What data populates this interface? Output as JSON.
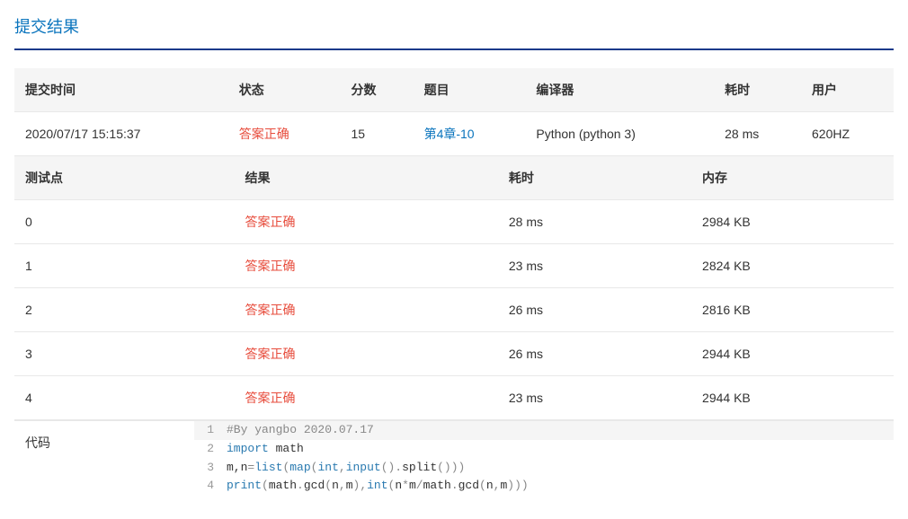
{
  "page_title": "提交结果",
  "summary": {
    "headers": {
      "submit_time": "提交时间",
      "status": "状态",
      "score": "分数",
      "problem": "题目",
      "compiler": "编译器",
      "time": "耗时",
      "user": "用户"
    },
    "row": {
      "submit_time": "2020/07/17 15:15:37",
      "status": "答案正确",
      "score": "15",
      "problem": "第4章-10",
      "compiler": "Python (python 3)",
      "time": "28 ms",
      "user": "620HZ"
    }
  },
  "testcases": {
    "headers": {
      "testcase": "测试点",
      "result": "结果",
      "time": "耗时",
      "memory": "内存"
    },
    "rows": [
      {
        "id": "0",
        "result": "答案正确",
        "time": "28 ms",
        "memory": "2984 KB"
      },
      {
        "id": "1",
        "result": "答案正确",
        "time": "23 ms",
        "memory": "2824 KB"
      },
      {
        "id": "2",
        "result": "答案正确",
        "time": "26 ms",
        "memory": "2816 KB"
      },
      {
        "id": "3",
        "result": "答案正确",
        "time": "26 ms",
        "memory": "2944 KB"
      },
      {
        "id": "4",
        "result": "答案正确",
        "time": "23 ms",
        "memory": "2944 KB"
      }
    ]
  },
  "code": {
    "label": "代码",
    "lines": [
      {
        "num": "1",
        "tokens": [
          {
            "cls": "cmt",
            "t": "#By yangbo 2020.07.17"
          }
        ]
      },
      {
        "num": "2",
        "tokens": [
          {
            "cls": "kw",
            "t": "import"
          },
          {
            "cls": "txt",
            "t": " math"
          }
        ]
      },
      {
        "num": "3",
        "tokens": [
          {
            "cls": "txt",
            "t": "m,n"
          },
          {
            "cls": "punct",
            "t": "="
          },
          {
            "cls": "fn",
            "t": "list"
          },
          {
            "cls": "punct",
            "t": "("
          },
          {
            "cls": "fn",
            "t": "map"
          },
          {
            "cls": "punct",
            "t": "("
          },
          {
            "cls": "fn",
            "t": "int"
          },
          {
            "cls": "punct",
            "t": ","
          },
          {
            "cls": "fn",
            "t": "input"
          },
          {
            "cls": "punct",
            "t": "()."
          },
          {
            "cls": "txt",
            "t": "split"
          },
          {
            "cls": "punct",
            "t": "()))"
          }
        ]
      },
      {
        "num": "4",
        "tokens": [
          {
            "cls": "fn",
            "t": "print"
          },
          {
            "cls": "punct",
            "t": "("
          },
          {
            "cls": "txt",
            "t": "math"
          },
          {
            "cls": "punct",
            "t": "."
          },
          {
            "cls": "txt",
            "t": "gcd"
          },
          {
            "cls": "punct",
            "t": "("
          },
          {
            "cls": "txt",
            "t": "n"
          },
          {
            "cls": "punct",
            "t": ","
          },
          {
            "cls": "txt",
            "t": "m"
          },
          {
            "cls": "punct",
            "t": "),"
          },
          {
            "cls": "fn",
            "t": "int"
          },
          {
            "cls": "punct",
            "t": "("
          },
          {
            "cls": "txt",
            "t": "n"
          },
          {
            "cls": "punct",
            "t": "*"
          },
          {
            "cls": "txt",
            "t": "m"
          },
          {
            "cls": "punct",
            "t": "/"
          },
          {
            "cls": "txt",
            "t": "math"
          },
          {
            "cls": "punct",
            "t": "."
          },
          {
            "cls": "txt",
            "t": "gcd"
          },
          {
            "cls": "punct",
            "t": "("
          },
          {
            "cls": "txt",
            "t": "n"
          },
          {
            "cls": "punct",
            "t": ","
          },
          {
            "cls": "txt",
            "t": "m"
          },
          {
            "cls": "punct",
            "t": ")))"
          }
        ]
      }
    ]
  }
}
